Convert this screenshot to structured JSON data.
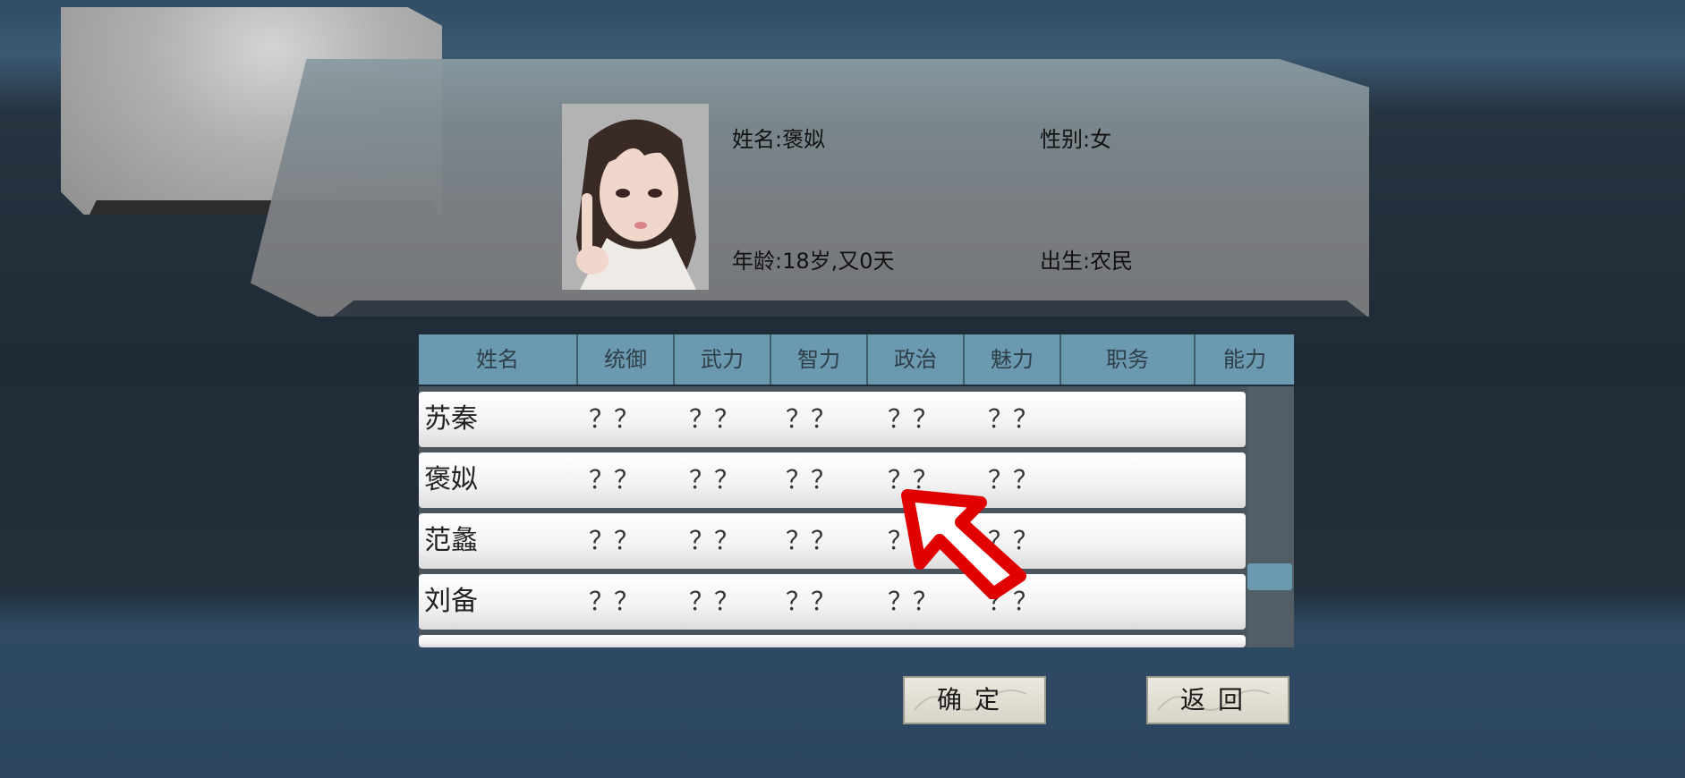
{
  "profile": {
    "name_label": "姓名:褒姒",
    "gender_label": "性别:女",
    "age_label": "年龄:18岁,又0天",
    "birth_label": "出生:农民"
  },
  "table": {
    "headers": [
      "姓名",
      "统御",
      "武力",
      "智力",
      "政治",
      "魅力",
      "职务",
      "能力"
    ],
    "rows": [
      {
        "name": "苏秦",
        "values": [
          "？？",
          "？？",
          "？？",
          "？？",
          "？？"
        ]
      },
      {
        "name": "褒姒",
        "values": [
          "？？",
          "？？",
          "？？",
          "？？",
          "？？"
        ]
      },
      {
        "name": "范蠡",
        "values": [
          "？？",
          "？？",
          "？？",
          "？？",
          "？？"
        ]
      },
      {
        "name": "刘备",
        "values": [
          "？？",
          "？？",
          "？？",
          "？？",
          "？？"
        ]
      }
    ]
  },
  "buttons": {
    "confirm": "确定",
    "back": "返回"
  },
  "colors": {
    "header_bg": "#6b9ab0",
    "cursor": "#e00000"
  },
  "icons": {
    "pointer": "arrow-pointer-icon"
  }
}
